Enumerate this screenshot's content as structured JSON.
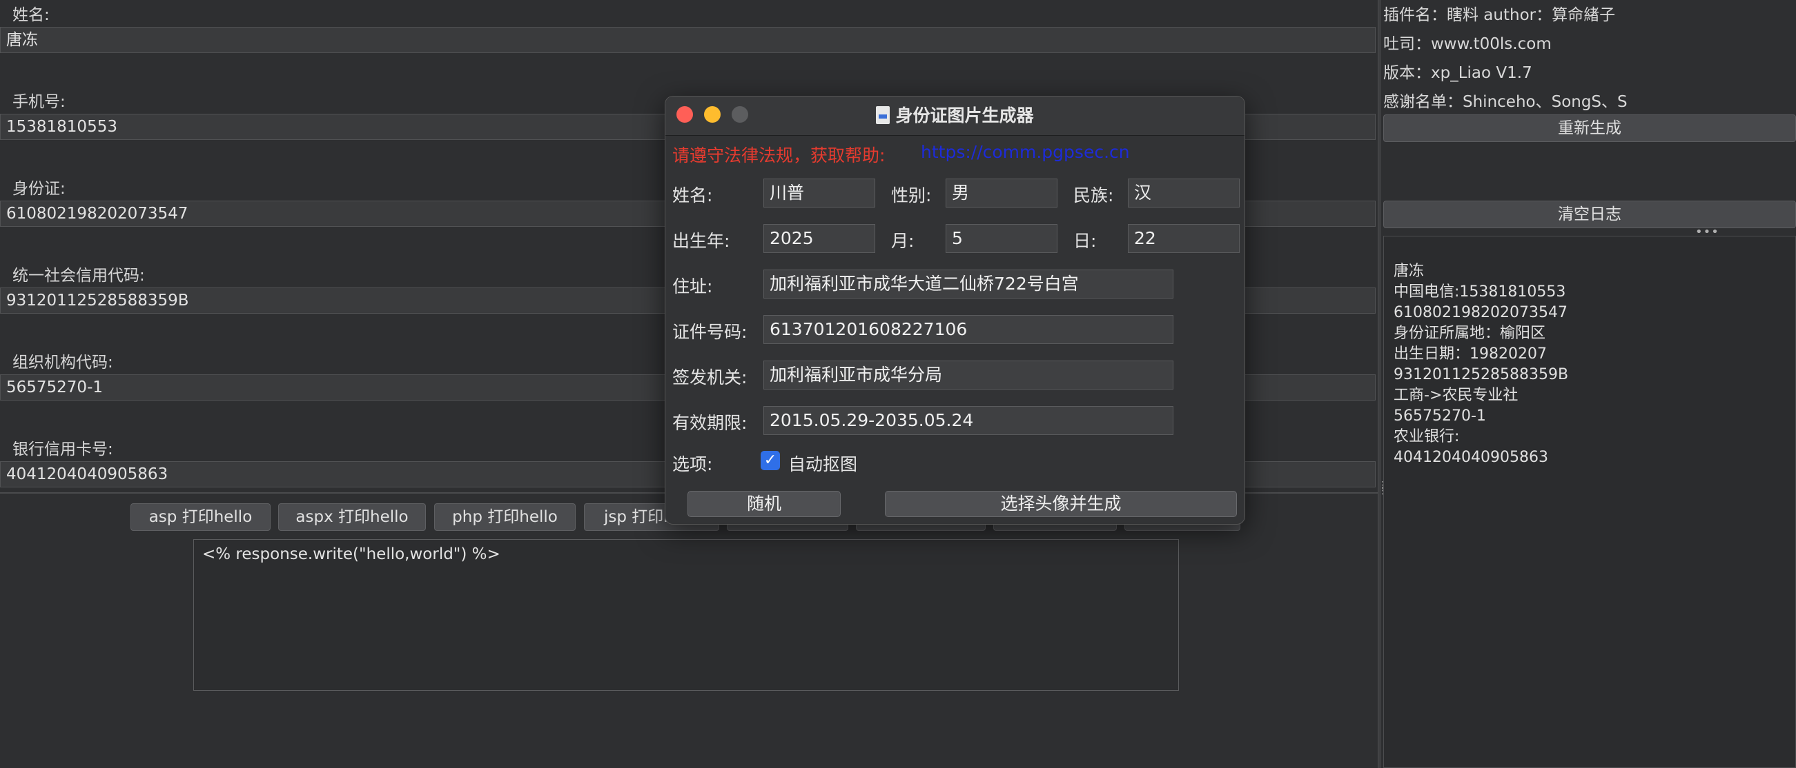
{
  "form": {
    "name_label": "姓名:",
    "name_value": "唐冻",
    "phone_label": "手机号:",
    "phone_value": "15381810553",
    "id_label": "身份证:",
    "id_value": "610802198202073547",
    "credit_code_label": "统一社会信用代码:",
    "credit_code_value": "93120112528588359B",
    "org_code_label": "组织机构代码:",
    "org_code_value": "56575270-1",
    "bank_label": "银行信用卡号:",
    "bank_value": "4041204040905863"
  },
  "toolbar": {
    "buttons": [
      "asp 打印hello",
      "aspx 打印hello",
      "php 打印hello",
      "jsp 打印hello"
    ]
  },
  "code": {
    "text": "<% response.write(\"hello,world\") %>"
  },
  "right_panel": {
    "plugin_line": "插件名：瞎料 author：算命緖子",
    "site_line": "吐司：www.t00ls.com",
    "version_line": "版本：xp_Liao V1.7",
    "thanks_line": "感谢名单：Shinceho、SongS、S",
    "regen_button": "重新生成",
    "clear_button": "清空日志",
    "log_lines": [
      "唐冻",
      "中国电信:15381810553",
      "610802198202073547",
      "身份证所属地：榆阳区",
      "出生日期：19820207",
      "93120112528588359B",
      "工商->农民专业社",
      "56575270-1",
      "农业银行:",
      "4041204040905863"
    ]
  },
  "dialog": {
    "title": "身份证图片生成器",
    "notice": "请遵守法律法规，获取帮助:",
    "link": "https://comm.pgpsec.cn",
    "name_label": "姓名:",
    "name_value": "川普",
    "gender_label": "性别:",
    "gender_value": "男",
    "ethnic_label": "民族:",
    "ethnic_value": "汉",
    "year_label": "出生年:",
    "year_value": "2025",
    "month_label": "月:",
    "month_value": "5",
    "day_label": "日:",
    "day_value": "22",
    "address_label": "住址:",
    "address_value": "加利福利亚市成华大道二仙桥722号白宫",
    "idnum_label": "证件号码:",
    "idnum_value": "613701201608227106",
    "issuer_label": "签发机关:",
    "issuer_value": "加利福利亚市成华分局",
    "validity_label": "有效期限:",
    "validity_value": "2015.05.29-2035.05.24",
    "options_label": "选项:",
    "auto_cutout_label": "自动抠图",
    "random_button": "随机",
    "generate_button": "选择头像并生成"
  },
  "colors": {
    "notice_red": "#e53b2f",
    "link_blue": "#1d2bd8",
    "checkbox_blue": "#2f6fe8",
    "close_red": "#ff5f57",
    "minimize_yellow": "#febc2e",
    "zoom_gray": "#5c5d5f"
  }
}
